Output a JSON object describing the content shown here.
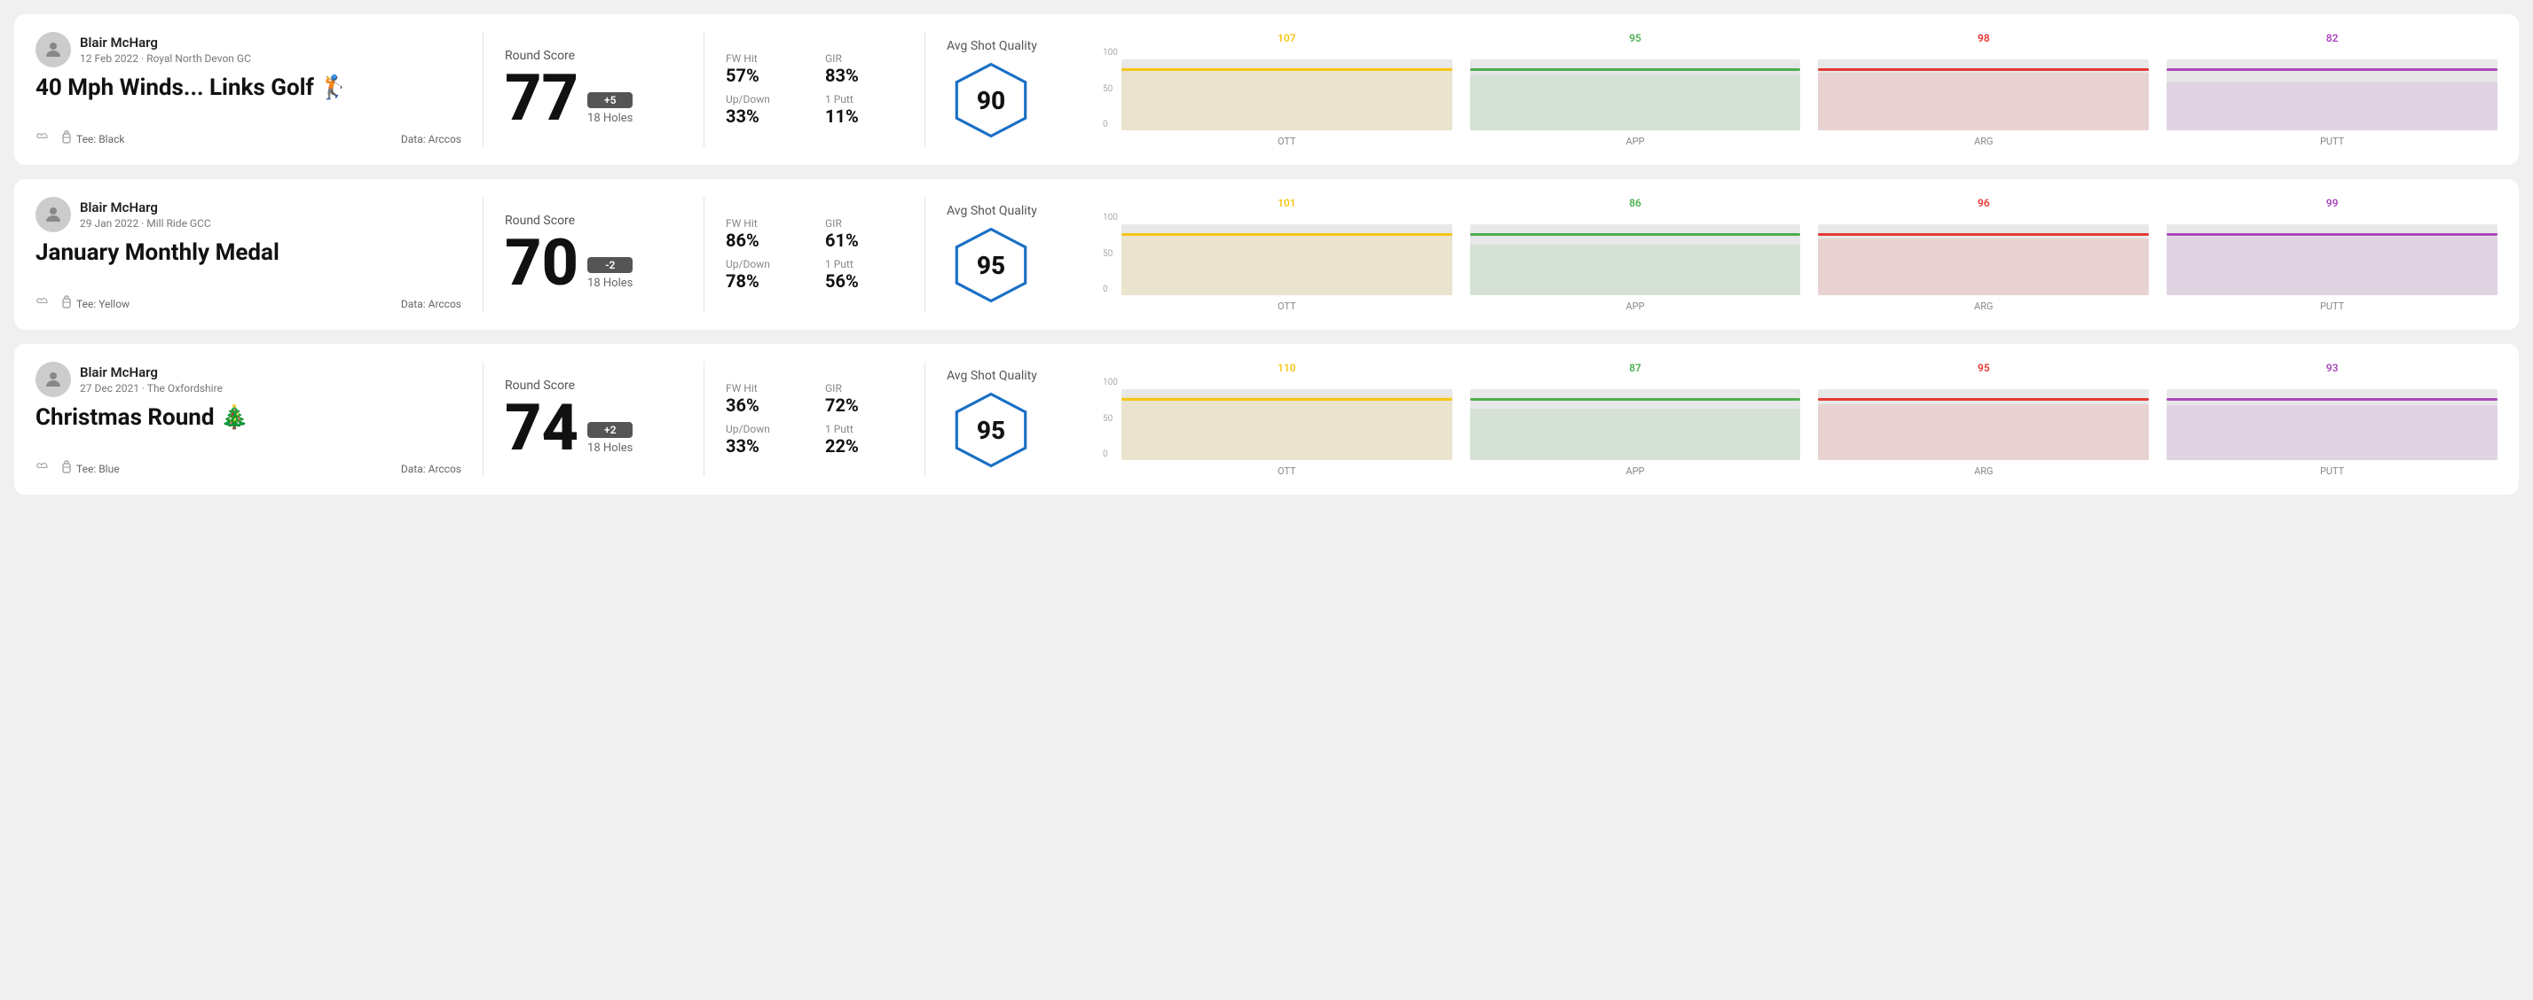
{
  "rounds": [
    {
      "id": "round1",
      "user": {
        "name": "Blair McHarg",
        "date_course": "12 Feb 2022 · Royal North Devon GC"
      },
      "title": "40 Mph Winds... Links Golf 🏌️",
      "tee": "Black",
      "data_source": "Data: Arccos",
      "score": {
        "label": "Round Score",
        "value": "77",
        "badge": "+5",
        "holes": "18 Holes"
      },
      "stats": {
        "fw_hit_label": "FW Hit",
        "fw_hit_value": "57%",
        "gir_label": "GIR",
        "gir_value": "83%",
        "updown_label": "Up/Down",
        "updown_value": "33%",
        "oneputt_label": "1 Putt",
        "oneputt_value": "11%"
      },
      "quality": {
        "label": "Avg Shot Quality",
        "score": "90"
      },
      "chart": {
        "bars": [
          {
            "label": "OTT",
            "value": 107,
            "color": "#f5c518",
            "max": 120
          },
          {
            "label": "APP",
            "value": 95,
            "color": "#4caf50",
            "max": 120
          },
          {
            "label": "ARG",
            "value": 98,
            "color": "#e53935",
            "max": 120
          },
          {
            "label": "PUTT",
            "value": 82,
            "color": "#ab47bc",
            "max": 120
          }
        ],
        "y_labels": [
          "100",
          "50",
          "0"
        ]
      }
    },
    {
      "id": "round2",
      "user": {
        "name": "Blair McHarg",
        "date_course": "29 Jan 2022 · Mill Ride GCC"
      },
      "title": "January Monthly Medal",
      "tee": "Yellow",
      "data_source": "Data: Arccos",
      "score": {
        "label": "Round Score",
        "value": "70",
        "badge": "-2",
        "holes": "18 Holes"
      },
      "stats": {
        "fw_hit_label": "FW Hit",
        "fw_hit_value": "86%",
        "gir_label": "GIR",
        "gir_value": "61%",
        "updown_label": "Up/Down",
        "updown_value": "78%",
        "oneputt_label": "1 Putt",
        "oneputt_value": "56%"
      },
      "quality": {
        "label": "Avg Shot Quality",
        "score": "95"
      },
      "chart": {
        "bars": [
          {
            "label": "OTT",
            "value": 101,
            "color": "#f5c518",
            "max": 120
          },
          {
            "label": "APP",
            "value": 86,
            "color": "#4caf50",
            "max": 120
          },
          {
            "label": "ARG",
            "value": 96,
            "color": "#e53935",
            "max": 120
          },
          {
            "label": "PUTT",
            "value": 99,
            "color": "#ab47bc",
            "max": 120
          }
        ],
        "y_labels": [
          "100",
          "50",
          "0"
        ]
      }
    },
    {
      "id": "round3",
      "user": {
        "name": "Blair McHarg",
        "date_course": "27 Dec 2021 · The Oxfordshire"
      },
      "title": "Christmas Round 🎄",
      "tee": "Blue",
      "data_source": "Data: Arccos",
      "score": {
        "label": "Round Score",
        "value": "74",
        "badge": "+2",
        "holes": "18 Holes"
      },
      "stats": {
        "fw_hit_label": "FW Hit",
        "fw_hit_value": "36%",
        "gir_label": "GIR",
        "gir_value": "72%",
        "updown_label": "Up/Down",
        "updown_value": "33%",
        "oneputt_label": "1 Putt",
        "oneputt_value": "22%"
      },
      "quality": {
        "label": "Avg Shot Quality",
        "score": "95"
      },
      "chart": {
        "bars": [
          {
            "label": "OTT",
            "value": 110,
            "color": "#f5c518",
            "max": 120
          },
          {
            "label": "APP",
            "value": 87,
            "color": "#4caf50",
            "max": 120
          },
          {
            "label": "ARG",
            "value": 95,
            "color": "#e53935",
            "max": 120
          },
          {
            "label": "PUTT",
            "value": 93,
            "color": "#ab47bc",
            "max": 120
          }
        ],
        "y_labels": [
          "100",
          "50",
          "0"
        ]
      }
    }
  ]
}
